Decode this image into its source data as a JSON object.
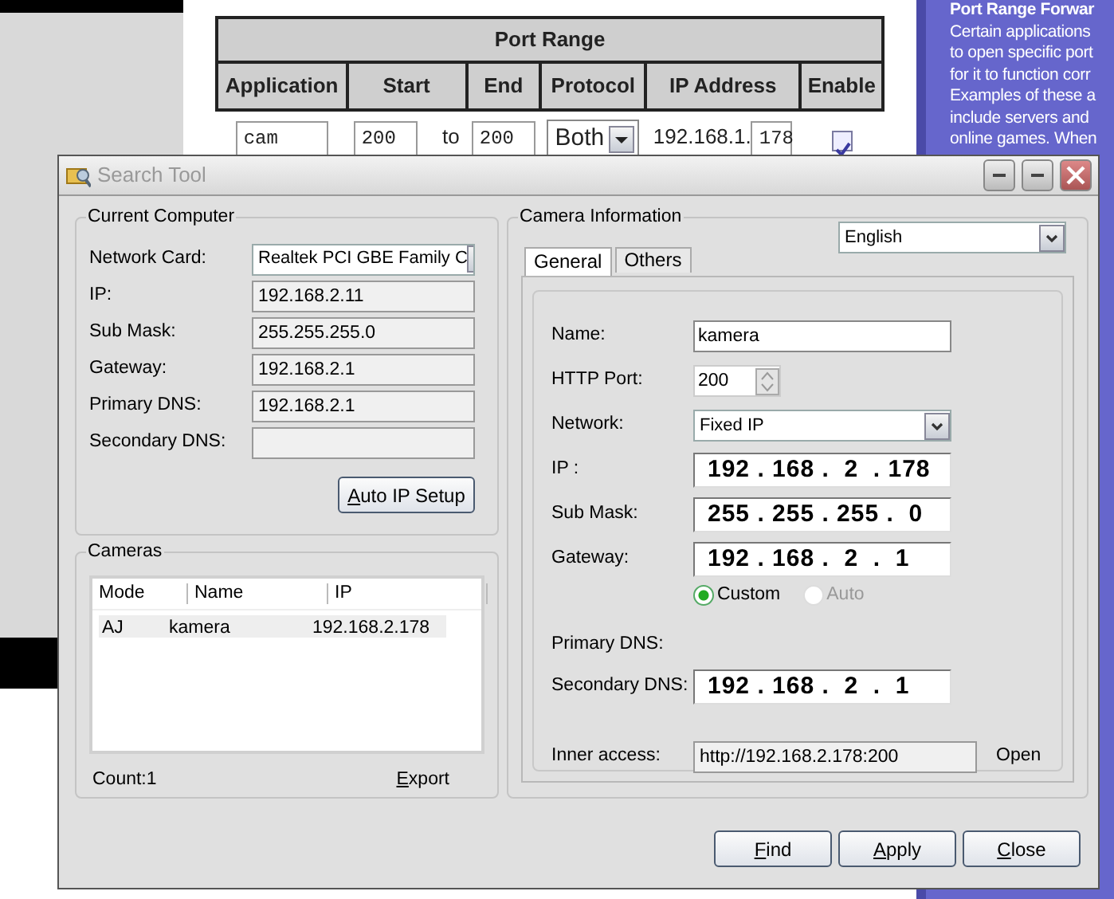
{
  "background_page": {
    "table": {
      "title": "Port Range",
      "columns": [
        "Application",
        "Start",
        "End",
        "Protocol",
        "IP Address",
        "Enable"
      ],
      "row": {
        "application": "cam",
        "start": "200",
        "separator": "to",
        "end": "200",
        "protocol": "Both",
        "ip_prefix": "192.168.1.",
        "ip_last": "178",
        "enabled": true
      }
    },
    "help_panel": {
      "title": "Port Range Forwar",
      "lines": [
        "Certain applications",
        "to open specific port",
        "for it to function corr",
        "Examples of these a",
        "include servers and",
        "online games. When"
      ]
    }
  },
  "window": {
    "title": "Search Tool",
    "current_computer": {
      "legend": "Current Computer",
      "fields": [
        {
          "label": "Network Card:",
          "kind": "select",
          "value": "Realtek PCI GBE Family C"
        },
        {
          "label": "IP:",
          "kind": "readonly",
          "value": "192.168.2.11"
        },
        {
          "label": "Sub Mask:",
          "kind": "readonly",
          "value": "255.255.255.0"
        },
        {
          "label": "Gateway:",
          "kind": "readonly",
          "value": "192.168.2.1"
        },
        {
          "label": "Primary DNS:",
          "kind": "readonly",
          "value": "192.168.2.1"
        },
        {
          "label": "Secondary DNS:",
          "kind": "readonly"
        }
      ],
      "auto_ip_button": {
        "label": "Auto IP Setup"
      }
    },
    "cameras": {
      "legend": "Cameras",
      "columns": [
        "Mode",
        "Name",
        "IP"
      ],
      "rows": [
        {
          "cells": [
            "AJ",
            "kamera",
            "192.168.2.178"
          ],
          "selected": true
        }
      ],
      "count": "Count:1",
      "export": {
        "label": "Export"
      }
    },
    "camera_information": {
      "legend": "Camera Information",
      "language": "English",
      "tabs": [
        {
          "label": "General",
          "selected": true
        },
        {
          "label": "Others",
          "selected": false
        }
      ],
      "fields": [
        {
          "label": "Name:",
          "kind": "text",
          "value": "kamera"
        },
        {
          "label": "HTTP Port:",
          "kind": "spinner",
          "value": "200"
        },
        {
          "label": "Network:",
          "kind": "select",
          "value": "Fixed IP"
        },
        {
          "label": "IP :",
          "kind": "ip",
          "value": "192 . 168 .  2  . 178"
        },
        {
          "label": "Sub Mask:",
          "kind": "ip",
          "value": "255 . 255 . 255 .  0"
        },
        {
          "label": "Gateway:",
          "kind": "ip",
          "value": "192 . 168 .  2  .  1"
        },
        {
          "kind": "radios",
          "options": [
            {
              "label": "Custom",
              "selected": true,
              "disabled": false
            },
            {
              "label": "Auto",
              "selected": false,
              "disabled": true
            }
          ]
        },
        {
          "label": "Primary DNS:",
          "kind": "none"
        },
        {
          "label": "Secondary DNS:",
          "kind": "ip",
          "value": "192 . 168 .  2  .  1"
        },
        {
          "label": "Inner access:",
          "kind": "link",
          "value": "http://192.168.2.178:200",
          "action": "Open"
        }
      ]
    },
    "buttons": [
      {
        "label": "Find"
      },
      {
        "label": "Apply"
      },
      {
        "label": "Close"
      }
    ]
  }
}
